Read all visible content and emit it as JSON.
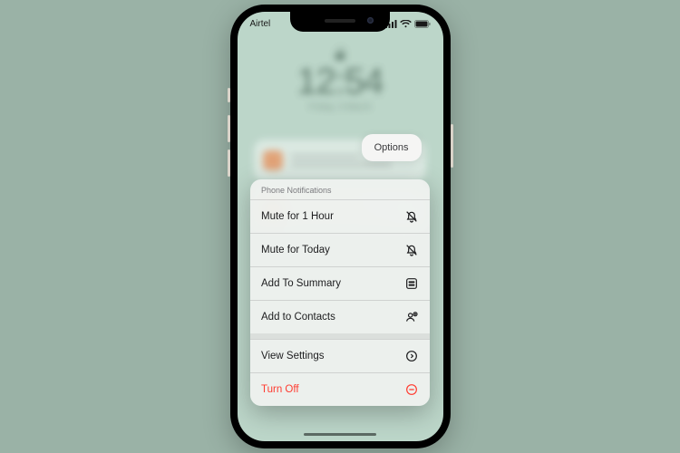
{
  "status": {
    "carrier": "Airtel"
  },
  "lockscreen": {
    "time": "12:54",
    "date_line": "Friday, 3 March"
  },
  "options_button": {
    "label": "Options"
  },
  "menu": {
    "header": "Phone Notifications",
    "items": [
      {
        "label": "Mute for 1 Hour",
        "icon": "bell-slash",
        "destructive": false
      },
      {
        "label": "Mute for Today",
        "icon": "bell-slash",
        "destructive": false
      },
      {
        "label": "Add To Summary",
        "icon": "summary",
        "destructive": false
      },
      {
        "label": "Add to Contacts",
        "icon": "contact-add",
        "destructive": false
      }
    ],
    "items2": [
      {
        "label": "View Settings",
        "icon": "chevron-circle",
        "destructive": false
      },
      {
        "label": "Turn Off",
        "icon": "minus-circle",
        "destructive": true
      }
    ]
  },
  "colors": {
    "page_bg": "#9ab2a6",
    "screen_bg": "#bcd6c9",
    "destructive": "#ff3b30"
  }
}
